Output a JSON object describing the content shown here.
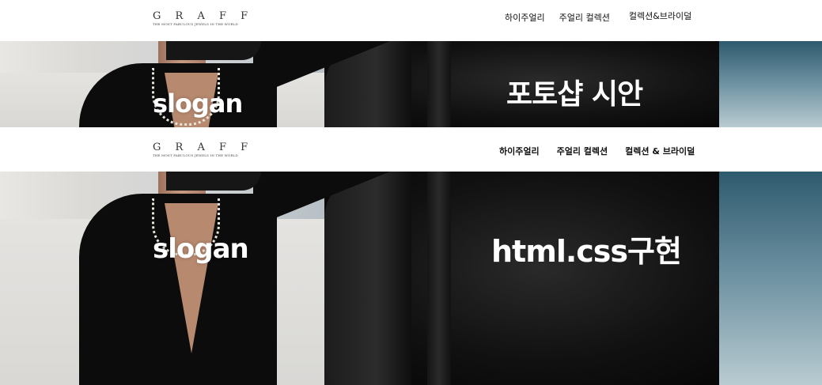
{
  "top_section": {
    "logo": {
      "word": "G R A F F",
      "tagline": "THE MOST FABULOUS JEWELS IN THE WORLD"
    },
    "nav": [
      "하이주얼리",
      "주얼리 컬렉션",
      "컬렉션&브라이덜"
    ],
    "hero": {
      "slogan": "slogan",
      "headline": "포토샵 시안"
    }
  },
  "bottom_section": {
    "logo": {
      "word": "G R A F F",
      "tagline": "THE MOST FABULOUS JEWELS IN THE WORLD"
    },
    "nav": [
      "하이주얼리",
      "주얼리 컬렉션",
      "컬렉션 & 브라이덜"
    ],
    "hero": {
      "slogan": "slogan",
      "headline": "html.css구현"
    }
  },
  "colors": {
    "header_bg": "#ffffff",
    "nav_text": "#111111",
    "hero_text": "#ffffff",
    "rock": "#111111"
  },
  "icons": [
    "graff-logo"
  ]
}
